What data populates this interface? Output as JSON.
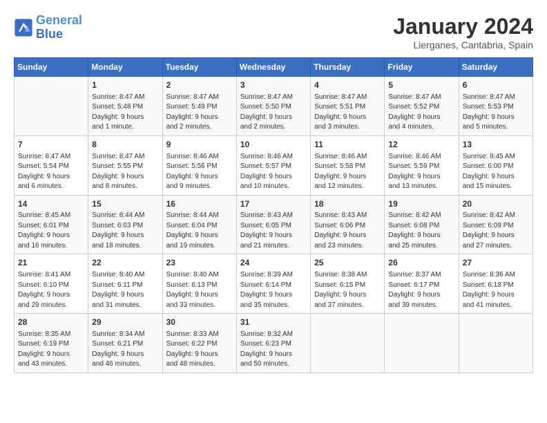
{
  "logo": {
    "line1": "General",
    "line2": "Blue"
  },
  "title": "January 2024",
  "subtitle": "Lierganes, Cantabria, Spain",
  "days_header": [
    "Sunday",
    "Monday",
    "Tuesday",
    "Wednesday",
    "Thursday",
    "Friday",
    "Saturday"
  ],
  "weeks": [
    [
      {
        "day": "",
        "info": ""
      },
      {
        "day": "1",
        "info": "Sunrise: 8:47 AM\nSunset: 5:48 PM\nDaylight: 9 hours\nand 1 minute."
      },
      {
        "day": "2",
        "info": "Sunrise: 8:47 AM\nSunset: 5:49 PM\nDaylight: 9 hours\nand 2 minutes."
      },
      {
        "day": "3",
        "info": "Sunrise: 8:47 AM\nSunset: 5:50 PM\nDaylight: 9 hours\nand 2 minutes."
      },
      {
        "day": "4",
        "info": "Sunrise: 8:47 AM\nSunset: 5:51 PM\nDaylight: 9 hours\nand 3 minutes."
      },
      {
        "day": "5",
        "info": "Sunrise: 8:47 AM\nSunset: 5:52 PM\nDaylight: 9 hours\nand 4 minutes."
      },
      {
        "day": "6",
        "info": "Sunrise: 8:47 AM\nSunset: 5:53 PM\nDaylight: 9 hours\nand 5 minutes."
      }
    ],
    [
      {
        "day": "7",
        "info": "Sunrise: 8:47 AM\nSunset: 5:54 PM\nDaylight: 9 hours\nand 6 minutes."
      },
      {
        "day": "8",
        "info": "Sunrise: 8:47 AM\nSunset: 5:55 PM\nDaylight: 9 hours\nand 8 minutes."
      },
      {
        "day": "9",
        "info": "Sunrise: 8:46 AM\nSunset: 5:56 PM\nDaylight: 9 hours\nand 9 minutes."
      },
      {
        "day": "10",
        "info": "Sunrise: 8:46 AM\nSunset: 5:57 PM\nDaylight: 9 hours\nand 10 minutes."
      },
      {
        "day": "11",
        "info": "Sunrise: 8:46 AM\nSunset: 5:58 PM\nDaylight: 9 hours\nand 12 minutes."
      },
      {
        "day": "12",
        "info": "Sunrise: 8:46 AM\nSunset: 5:59 PM\nDaylight: 9 hours\nand 13 minutes."
      },
      {
        "day": "13",
        "info": "Sunrise: 8:45 AM\nSunset: 6:00 PM\nDaylight: 9 hours\nand 15 minutes."
      }
    ],
    [
      {
        "day": "14",
        "info": "Sunrise: 8:45 AM\nSunset: 6:01 PM\nDaylight: 9 hours\nand 16 minutes."
      },
      {
        "day": "15",
        "info": "Sunrise: 8:44 AM\nSunset: 6:03 PM\nDaylight: 9 hours\nand 18 minutes."
      },
      {
        "day": "16",
        "info": "Sunrise: 8:44 AM\nSunset: 6:04 PM\nDaylight: 9 hours\nand 19 minutes."
      },
      {
        "day": "17",
        "info": "Sunrise: 8:43 AM\nSunset: 6:05 PM\nDaylight: 9 hours\nand 21 minutes."
      },
      {
        "day": "18",
        "info": "Sunrise: 8:43 AM\nSunset: 6:06 PM\nDaylight: 9 hours\nand 23 minutes."
      },
      {
        "day": "19",
        "info": "Sunrise: 8:42 AM\nSunset: 6:08 PM\nDaylight: 9 hours\nand 25 minutes."
      },
      {
        "day": "20",
        "info": "Sunrise: 8:42 AM\nSunset: 6:09 PM\nDaylight: 9 hours\nand 27 minutes."
      }
    ],
    [
      {
        "day": "21",
        "info": "Sunrise: 8:41 AM\nSunset: 6:10 PM\nDaylight: 9 hours\nand 29 minutes."
      },
      {
        "day": "22",
        "info": "Sunrise: 8:40 AM\nSunset: 6:11 PM\nDaylight: 9 hours\nand 31 minutes."
      },
      {
        "day": "23",
        "info": "Sunrise: 8:40 AM\nSunset: 6:13 PM\nDaylight: 9 hours\nand 33 minutes."
      },
      {
        "day": "24",
        "info": "Sunrise: 8:39 AM\nSunset: 6:14 PM\nDaylight: 9 hours\nand 35 minutes."
      },
      {
        "day": "25",
        "info": "Sunrise: 8:38 AM\nSunset: 6:15 PM\nDaylight: 9 hours\nand 37 minutes."
      },
      {
        "day": "26",
        "info": "Sunrise: 8:37 AM\nSunset: 6:17 PM\nDaylight: 9 hours\nand 39 minutes."
      },
      {
        "day": "27",
        "info": "Sunrise: 8:36 AM\nSunset: 6:18 PM\nDaylight: 9 hours\nand 41 minutes."
      }
    ],
    [
      {
        "day": "28",
        "info": "Sunrise: 8:35 AM\nSunset: 6:19 PM\nDaylight: 9 hours\nand 43 minutes."
      },
      {
        "day": "29",
        "info": "Sunrise: 8:34 AM\nSunset: 6:21 PM\nDaylight: 9 hours\nand 46 minutes."
      },
      {
        "day": "30",
        "info": "Sunrise: 8:33 AM\nSunset: 6:22 PM\nDaylight: 9 hours\nand 48 minutes."
      },
      {
        "day": "31",
        "info": "Sunrise: 8:32 AM\nSunset: 6:23 PM\nDaylight: 9 hours\nand 50 minutes."
      },
      {
        "day": "",
        "info": ""
      },
      {
        "day": "",
        "info": ""
      },
      {
        "day": "",
        "info": ""
      }
    ]
  ]
}
